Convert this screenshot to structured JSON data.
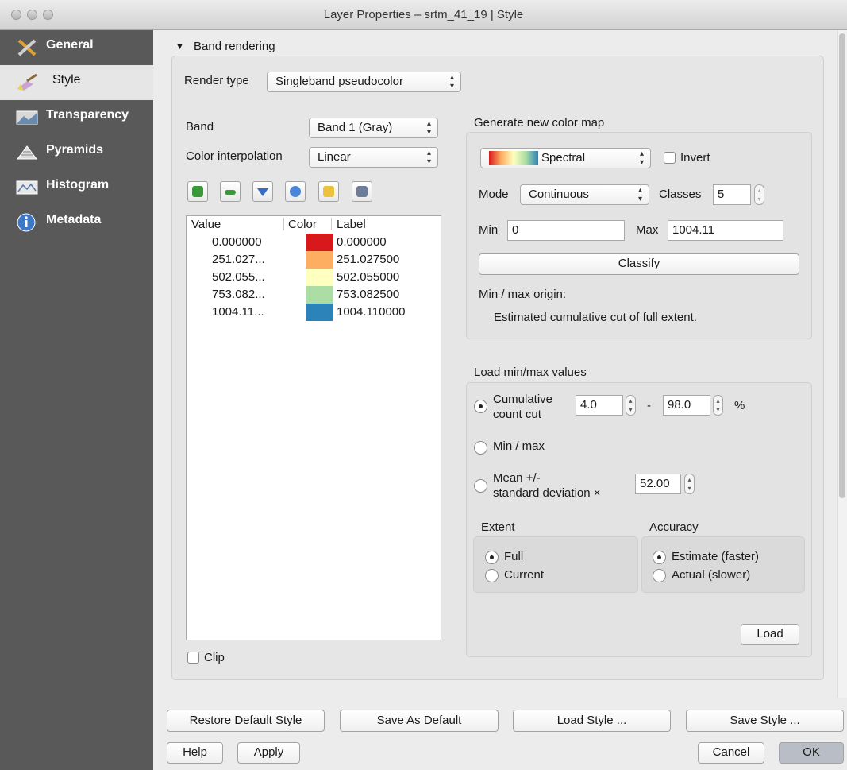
{
  "window": {
    "title": "Layer Properties – srtm_41_19 | Style"
  },
  "sidebar": {
    "items": [
      {
        "label": "General",
        "icon": "tools-icon",
        "active": false
      },
      {
        "label": "Style",
        "icon": "paintbrush-icon",
        "active": true
      },
      {
        "label": "Transparency",
        "icon": "transparency-icon",
        "active": false
      },
      {
        "label": "Pyramids",
        "icon": "pyramids-icon",
        "active": false
      },
      {
        "label": "Histogram",
        "icon": "histogram-icon",
        "active": false
      },
      {
        "label": "Metadata",
        "icon": "info-icon",
        "active": false
      }
    ]
  },
  "band_rendering": {
    "section_title": "Band rendering",
    "render_type_label": "Render type",
    "render_type_value": "Singleband pseudocolor",
    "band_label": "Band",
    "band_value": "Band 1 (Gray)",
    "interp_label": "Color interpolation",
    "interp_value": "Linear",
    "table": {
      "headers": [
        "Value",
        "Color",
        "Label"
      ],
      "rows": [
        {
          "value": "0.000000",
          "color": "#d7191c",
          "label": "0.000000"
        },
        {
          "value": "251.027...",
          "color": "#fdae61",
          "label": "251.027500"
        },
        {
          "value": "502.055...",
          "color": "#ffffbf",
          "label": "502.055000"
        },
        {
          "value": "753.082...",
          "color": "#abdda4",
          "label": "753.082500"
        },
        {
          "value": "1004.11...",
          "color": "#2b83ba",
          "label": "1004.110000"
        }
      ]
    },
    "clip_label": "Clip"
  },
  "color_map": {
    "group_title": "Generate new color map",
    "ramp_value": "Spectral",
    "invert_label": "Invert",
    "mode_label": "Mode",
    "mode_value": "Continuous",
    "classes_label": "Classes",
    "classes_value": "5",
    "min_label": "Min",
    "min_value": "0",
    "max_label": "Max",
    "max_value": "1004.11",
    "classify_label": "Classify",
    "origin_label": "Min / max origin:",
    "origin_value": "Estimated cumulative cut of full extent."
  },
  "minmax": {
    "group_title": "Load min/max values",
    "cumulative_label_1": "Cumulative",
    "cumulative_label_2": "count cut",
    "cut_low": "4.0",
    "cut_sep": "-",
    "cut_high": "98.0",
    "cut_unit": "%",
    "minmax_label": "Min / max",
    "mean_label_1": "Mean +/-",
    "mean_label_2": "standard deviation ×",
    "stddev_value": "52.00",
    "extent_title": "Extent",
    "extent_full": "Full",
    "extent_current": "Current",
    "accuracy_title": "Accuracy",
    "accuracy_estimate": "Estimate (faster)",
    "accuracy_actual": "Actual (slower)",
    "load_label": "Load"
  },
  "footer": {
    "restore_default": "Restore Default Style",
    "save_default": "Save As Default",
    "load_style": "Load Style ...",
    "save_style": "Save Style ...",
    "help": "Help",
    "apply": "Apply",
    "cancel": "Cancel",
    "ok": "OK"
  },
  "colors": {
    "sidebar_bg": "#595959",
    "ok_button": "#b9bec6",
    "spectral_ramp": [
      "#d7191c",
      "#fdae61",
      "#ffffbf",
      "#abdda4",
      "#2b83ba"
    ]
  }
}
